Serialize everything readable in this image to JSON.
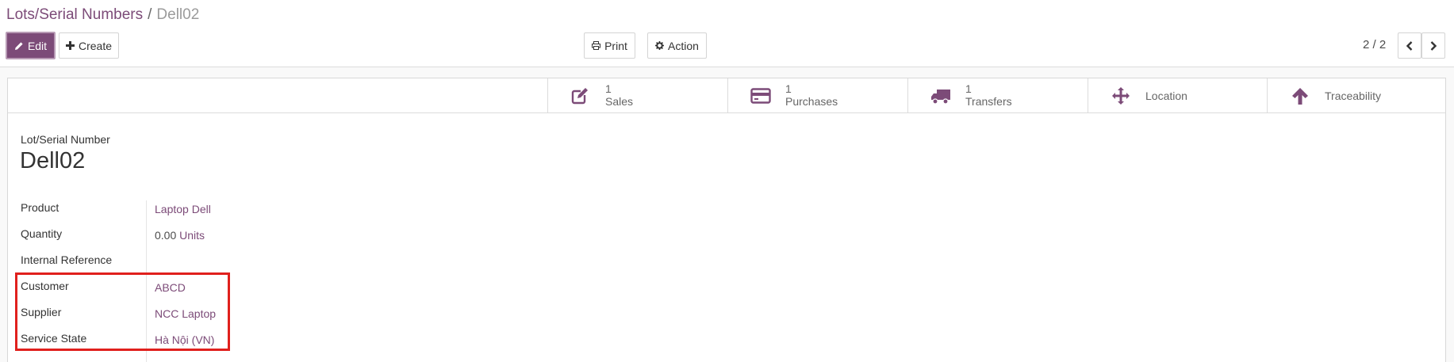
{
  "breadcrumb": {
    "parent": "Lots/Serial Numbers",
    "separator": "/",
    "current": "Dell02"
  },
  "toolbar": {
    "edit_label": "Edit",
    "create_label": "Create",
    "print_label": "Print",
    "action_label": "Action"
  },
  "pager": {
    "value": "2 / 2"
  },
  "smart_buttons": [
    {
      "value": "1",
      "label": "Sales",
      "icon": "edit-icon"
    },
    {
      "value": "1",
      "label": "Purchases",
      "icon": "credit-card-icon"
    },
    {
      "value": "1",
      "label": "Transfers",
      "icon": "truck-icon"
    },
    {
      "value": "",
      "label": "Location",
      "icon": "arrows-icon"
    },
    {
      "value": "",
      "label": "Traceability",
      "icon": "arrow-up-icon"
    }
  ],
  "form": {
    "title_label": "Lot/Serial Number",
    "record_name": "Dell02",
    "fields": [
      {
        "label": "Product",
        "value": "Laptop Dell"
      },
      {
        "label": "Quantity",
        "value": "0.00",
        "unit": "Units"
      },
      {
        "label": "Internal Reference",
        "value": ""
      },
      {
        "label": "Customer",
        "value": "ABCD"
      },
      {
        "label": "Supplier",
        "value": "NCC Laptop"
      },
      {
        "label": "Service State",
        "value": "Hà Nội (VN)"
      }
    ]
  },
  "colors": {
    "brand": "#7c4b78",
    "highlight": "#e0201d"
  }
}
